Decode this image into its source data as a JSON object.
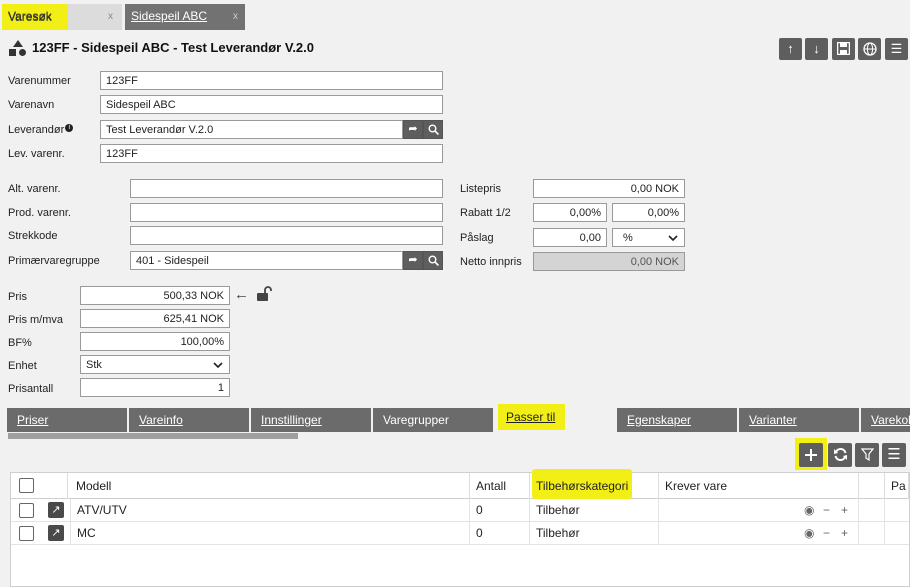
{
  "top_tabs": [
    {
      "label": "Varesøk",
      "close": "x"
    },
    {
      "label": "Sidespeil ABC",
      "close": "x"
    }
  ],
  "header": {
    "title": "123FF - Sidespeil ABC - Test Leverandør V.2.0",
    "buttons": [
      "arrow-up-icon",
      "arrow-down-icon",
      "save-icon",
      "globe-icon",
      "menu-icon"
    ]
  },
  "form": {
    "varenummer": {
      "label": "Varenummer",
      "value": "123FF"
    },
    "varenavn": {
      "label": "Varenavn",
      "value": "Sidespeil ABC"
    },
    "leverandor": {
      "label": "Leverandør",
      "info": "i",
      "value": "Test Leverandør V.2.0"
    },
    "lev_varenr": {
      "label": "Lev. varenr.",
      "value": "123FF"
    },
    "alt_varenr": {
      "label": "Alt. varenr.",
      "value": ""
    },
    "prod_varenr": {
      "label": "Prod. varenr.",
      "value": ""
    },
    "strekkode": {
      "label": "Strekkode",
      "value": ""
    },
    "primaervaregruppe": {
      "label": "Primærvaregruppe",
      "value": "401 - Sidespeil"
    },
    "listepris": {
      "label": "Listepris",
      "value": "0,00 NOK"
    },
    "rabatt": {
      "label": "Rabatt 1/2",
      "value1": "0,00%",
      "value2": "0,00%"
    },
    "paslag": {
      "label": "Påslag",
      "value": "0,00",
      "unit": "%"
    },
    "netto_innpris": {
      "label": "Netto innpris",
      "value": "0,00 NOK"
    },
    "pris": {
      "label": "Pris",
      "value": "500,33 NOK"
    },
    "pris_mva": {
      "label": "Pris m/mva",
      "value": "625,41 NOK"
    },
    "bf": {
      "label": "BF%",
      "value": "100,00%"
    },
    "enhet": {
      "label": "Enhet",
      "value": "Stk"
    },
    "prisantall": {
      "label": "Prisantall",
      "value": "1"
    }
  },
  "lower_tabs": [
    {
      "label": "Priser"
    },
    {
      "label": "Vareinfo"
    },
    {
      "label": "Innstillinger"
    },
    {
      "label": "Varegrupper"
    },
    {
      "label": "Passer til",
      "active": true
    },
    {
      "label": "Egenskaper"
    },
    {
      "label": "Varianter"
    },
    {
      "label": "Varekol"
    }
  ],
  "table": {
    "columns": [
      "Modell",
      "Antall",
      "Tilbehørskategori",
      "Krever vare",
      "Pa"
    ],
    "rows": [
      {
        "modell": "ATV/UTV",
        "antall": "0",
        "kategori": "Tilbehør"
      },
      {
        "modell": "MC",
        "antall": "0",
        "kategori": "Tilbehør"
      }
    ]
  },
  "colors": {
    "highlight": "#f2ef16",
    "button_gray": "#5e5e5e",
    "tab_gray": "#6b6b6b"
  }
}
